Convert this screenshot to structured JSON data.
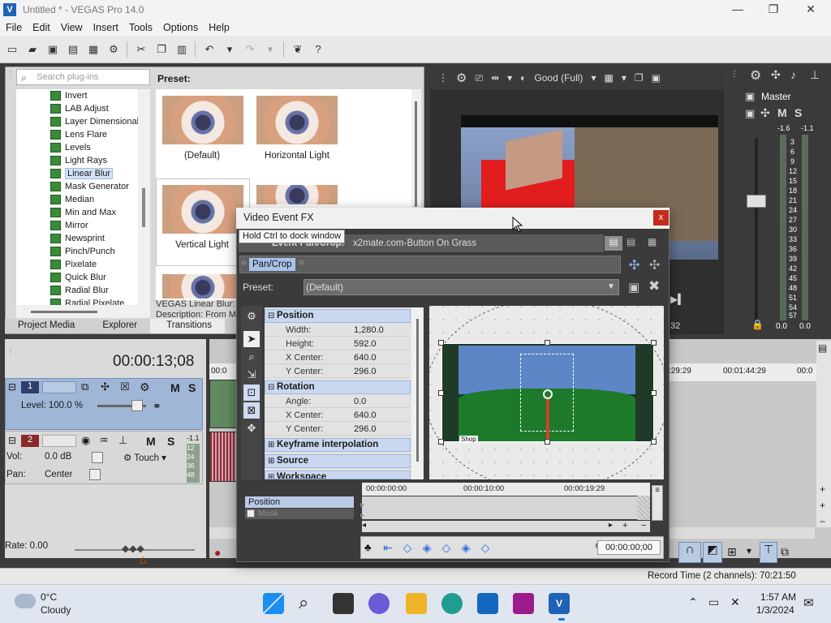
{
  "window": {
    "title": "Untitled * - VEGAS Pro 14.0",
    "min_glyph": "—",
    "max_glyph": "❐",
    "close_glyph": "✕"
  },
  "menu": [
    "File",
    "Edit",
    "View",
    "Insert",
    "Tools",
    "Options",
    "Help"
  ],
  "plugins": {
    "search_placeholder": "Search plug-ins",
    "items": [
      "Invert",
      "LAB Adjust",
      "Layer Dimensional",
      "Lens Flare",
      "Levels",
      "Light Rays",
      "Linear Blur",
      "Mask Generator",
      "Median",
      "Min and Max",
      "Mirror",
      "Newsprint",
      "Pinch/Punch",
      "Pixelate",
      "Quick Blur",
      "Radial Blur",
      "Radial Pixelate"
    ],
    "selected_index": 6,
    "preset_label": "Preset:",
    "presets": [
      "(Default)",
      "Horizontal Light",
      "Vertical Light"
    ],
    "description_line1": "VEGAS Linear Blur: O",
    "description_line2": "Description: From Ma"
  },
  "tabs": [
    "Project Media",
    "Explorer",
    "Transitions"
  ],
  "preview": {
    "quality": "Good (Full)",
    "frame_number": "32"
  },
  "master": {
    "label": "Master",
    "peak_left": "-1.6",
    "peak_right": "-1.1",
    "scale": [
      "3",
      "6",
      "9",
      "12",
      "15",
      "18",
      "21",
      "24",
      "27",
      "30",
      "33",
      "36",
      "39",
      "42",
      "45",
      "48",
      "51",
      "54",
      "57"
    ],
    "level_left": "0.0",
    "level_right": "0.0"
  },
  "timeline": {
    "timecode": "00:00:13;08",
    "track1_number": "1",
    "track1_level": "Level: 100.0 %",
    "track2_number": "2",
    "track2_vol": "Vol:",
    "track2_vol_value": "0.0 dB",
    "track2_pan": "Pan:",
    "track2_pan_value": "Center",
    "track2_mode": "Touch",
    "track2_peak": "-1.1",
    "track2_scale": [
      "12",
      "24",
      "36",
      "48"
    ],
    "ruler_left": "00:0",
    "ruler_1": ":29:29",
    "ruler_2": "00:01:44:29",
    "ruler_3": "00:0",
    "rate": "Rate: 0.00",
    "record_time": "Record Time (2 channels): 70:21:50"
  },
  "dialog": {
    "title": "Video Event FX",
    "close_glyph": "x",
    "tooltip": "Hold Ctrl to dock window",
    "event_label": "Event Pan/Crop:",
    "event_value": "x2mate.com-Button On Grass",
    "chain_item": "Pan/Crop",
    "preset_label": "Preset:",
    "preset_value": "(Default)",
    "sections": {
      "position": "Position",
      "rotation": "Rotation",
      "keyframe": "Keyframe interpolation",
      "source": "Source",
      "workspace": "Workspace"
    },
    "position_rows": [
      {
        "name": "Width:",
        "value": "1,280.0"
      },
      {
        "name": "Height:",
        "value": "592.0"
      },
      {
        "name": "X Center:",
        "value": "640.0"
      },
      {
        "name": "Y Center:",
        "value": "296.0"
      }
    ],
    "rotation_rows": [
      {
        "name": "Angle:",
        "value": "0.0"
      },
      {
        "name": "X Center:",
        "value": "640.0"
      },
      {
        "name": "Y Center:",
        "value": "296.0"
      }
    ],
    "shop_label": "Shop",
    "keyframes": {
      "position_label": "Position",
      "mask_label": "Mask",
      "ruler": [
        "00:00:00:00",
        "00:00:10:00",
        "00:00:19:29"
      ],
      "time": "00:00:00;00"
    }
  },
  "taskbar": {
    "temperature": "0°C",
    "weather": "Cloudy",
    "time": "1:57 AM",
    "date": "1/3/2024"
  },
  "colors": {
    "accent": "#1e63b6",
    "selection": "#a8c3ea",
    "close_red": "#c42b1c"
  }
}
